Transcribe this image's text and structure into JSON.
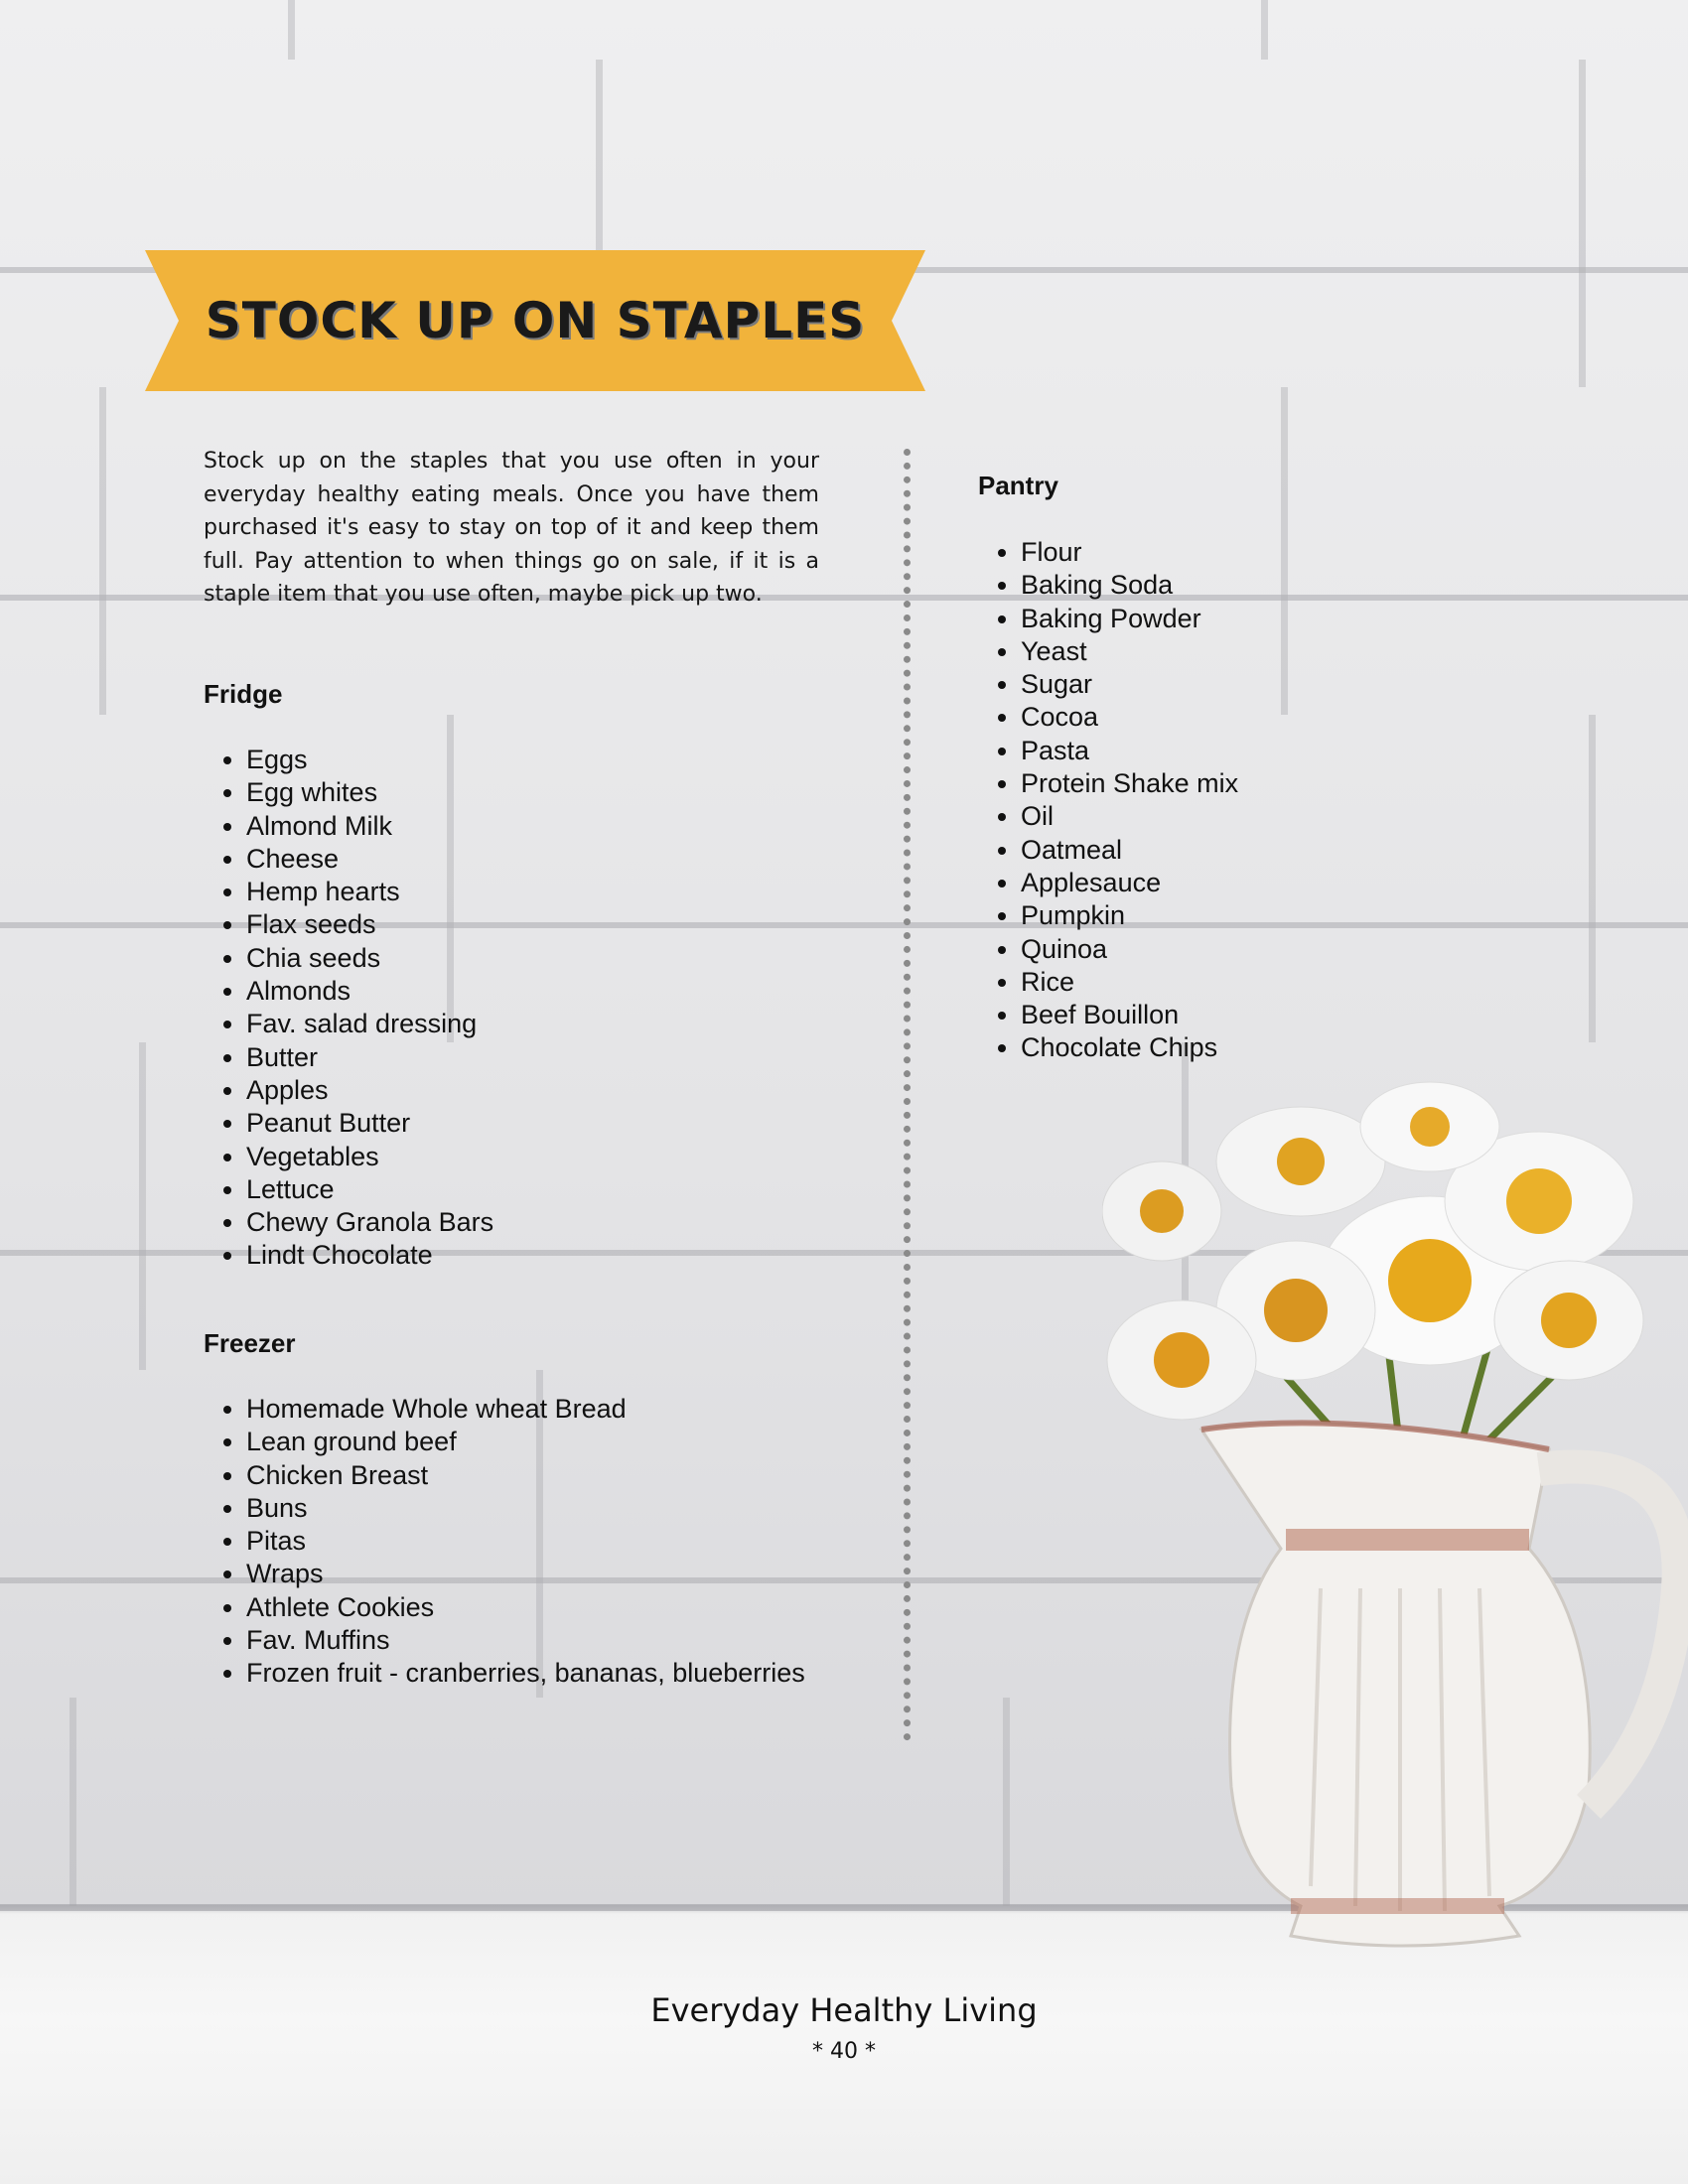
{
  "banner": {
    "title": "STOCK UP ON STAPLES",
    "color": "#F1B33B"
  },
  "intro": "Stock up on the staples that you use often in your everyday healthy eating meals.  Once you have them purchased it's easy to stay on top of it and keep them full.  Pay attention to when things go on sale, if it is a staple item that you use often, maybe pick up two.",
  "fridge": {
    "heading": "Fridge",
    "items": [
      "Eggs",
      "Egg whites",
      "Almond Milk",
      "Cheese",
      "Hemp hearts",
      "Flax seeds",
      "Chia seeds",
      "Almonds",
      "Fav. salad dressing",
      "Butter",
      "Apples",
      "Peanut Butter",
      "Vegetables",
      "Lettuce",
      "Chewy Granola Bars",
      "Lindt Chocolate"
    ]
  },
  "freezer": {
    "heading": "Freezer",
    "items": [
      "Homemade Whole wheat Bread",
      "Lean ground beef",
      "Chicken Breast",
      "Buns",
      "Pitas",
      "Wraps",
      "Athlete Cookies",
      "Fav. Muffins",
      "Frozen fruit - cranberries, bananas, blueberries"
    ]
  },
  "pantry": {
    "heading": "Pantry",
    "items": [
      "Flour",
      "Baking Soda",
      "Baking Powder",
      "Yeast",
      "Sugar",
      "Cocoa",
      "Pasta",
      "Protein Shake mix",
      "Oil",
      "Oatmeal",
      "Applesauce",
      "Pumpkin",
      "Quinoa",
      "Rice",
      "Beef Bouillon",
      "Chocolate Chips"
    ]
  },
  "footer": {
    "title": "Everyday Healthy Living",
    "page": "* 40 *"
  }
}
